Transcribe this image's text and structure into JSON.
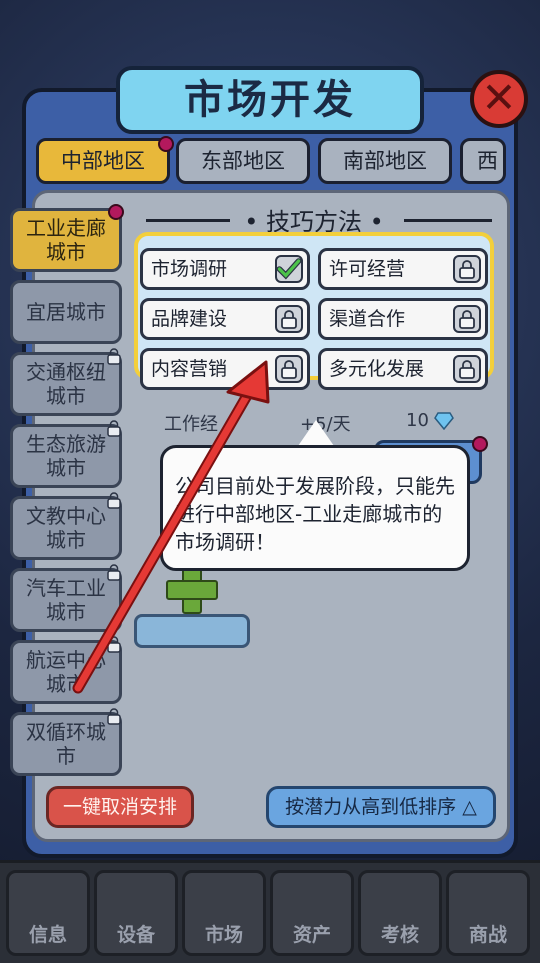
{
  "title": "市场开发",
  "close_icon": "close-icon",
  "region_tabs": [
    {
      "label": "中部地区",
      "active": true,
      "badge": true
    },
    {
      "label": "东部地区",
      "active": false
    },
    {
      "label": "南部地区",
      "active": false
    },
    {
      "label": "西部",
      "active": false
    }
  ],
  "cities": [
    {
      "label": "工业走廊城市",
      "active": true,
      "badge": true
    },
    {
      "label": "宜居城市",
      "locked": false
    },
    {
      "label": "交通枢纽城市",
      "locked": true
    },
    {
      "label": "生态旅游城市",
      "locked": true
    },
    {
      "label": "文教中心城市",
      "locked": true
    },
    {
      "label": "汽车工业城市",
      "locked": true
    },
    {
      "label": "航运中心城市",
      "locked": true
    },
    {
      "label": "双循环城市",
      "locked": true
    }
  ],
  "section_title": "技巧方法",
  "skills": [
    {
      "label": "市场调研",
      "status": "checked",
      "icon": "check-icon"
    },
    {
      "label": "许可经营",
      "status": "locked",
      "icon": "lock-icon"
    },
    {
      "label": "品牌建设",
      "status": "locked",
      "icon": "lock-icon"
    },
    {
      "label": "渠道合作",
      "status": "locked",
      "icon": "lock-icon"
    },
    {
      "label": "内容营销",
      "status": "locked",
      "icon": "lock-icon"
    },
    {
      "label": "多元化发展",
      "status": "locked",
      "icon": "lock-icon"
    }
  ],
  "stats": {
    "work_label": "工作经",
    "rate": "+5/天",
    "cost": "10",
    "cost_icon": "diamond-icon"
  },
  "tooltip": "公司目前处于发展阶段，只能先进行中部地区-工业走廊城市的市场调研！",
  "buttons": {
    "cancel_all": "一键取消安排",
    "sort": "按潜力从高到低排序"
  },
  "bottom_nav": [
    "信息",
    "设备",
    "市场",
    "资产",
    "考核",
    "商战"
  ],
  "colors": {
    "accent": "#e8b83a",
    "panel": "#3d5fa6",
    "arrow": "#e53935"
  }
}
